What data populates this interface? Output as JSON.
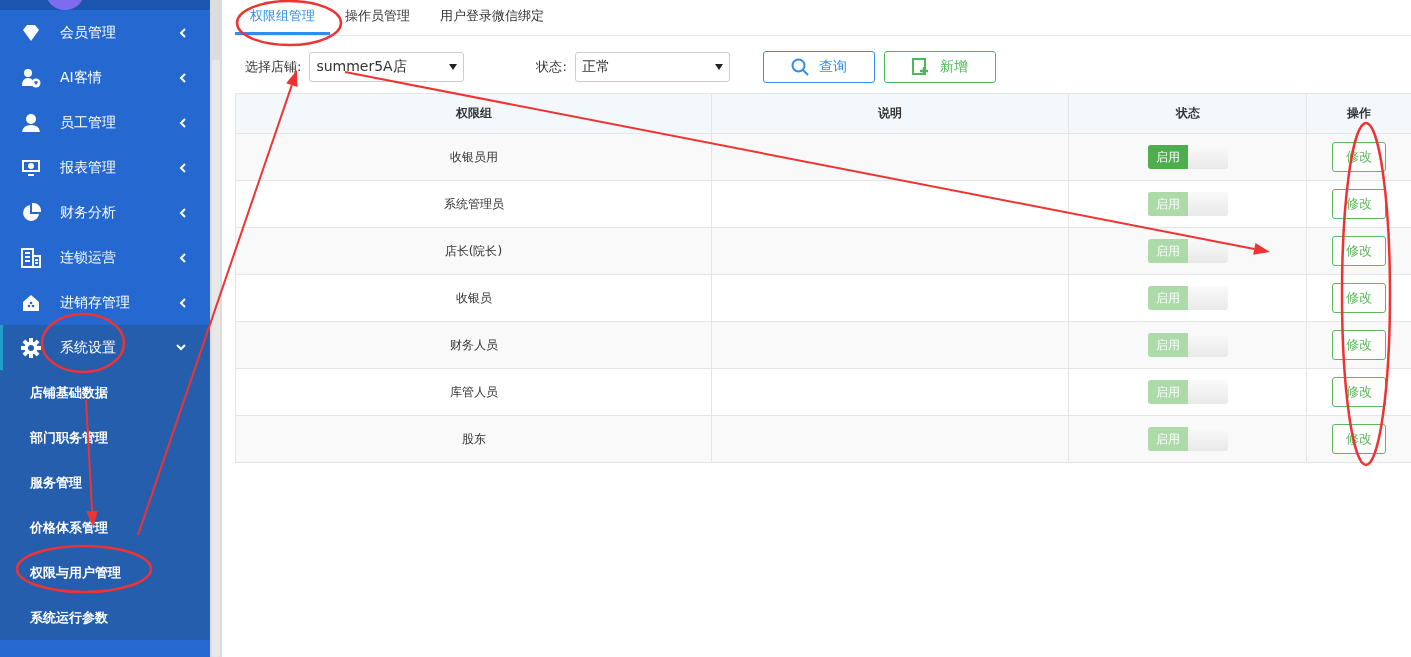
{
  "sidebar": {
    "items": [
      {
        "label": "会员管理",
        "expanded": false
      },
      {
        "label": "AI客情",
        "expanded": false
      },
      {
        "label": "员工管理",
        "expanded": false
      },
      {
        "label": "报表管理",
        "expanded": false
      },
      {
        "label": "财务分析",
        "expanded": false
      },
      {
        "label": "连锁运营",
        "expanded": false
      },
      {
        "label": "进销存管理",
        "expanded": false
      },
      {
        "label": "系统设置",
        "expanded": true,
        "children": [
          {
            "label": "店铺基础数据"
          },
          {
            "label": "部门职务管理"
          },
          {
            "label": "服务管理"
          },
          {
            "label": "价格体系管理"
          },
          {
            "label": "权限与用户管理"
          },
          {
            "label": "系统运行参数"
          }
        ]
      }
    ]
  },
  "tabs": [
    {
      "label": "权限组管理",
      "selected": true
    },
    {
      "label": "操作员管理",
      "selected": false
    },
    {
      "label": "用户登录微信绑定",
      "selected": false
    }
  ],
  "filters": [
    {
      "label": "选择店铺:",
      "value": "summer5A店"
    },
    {
      "label": "状态:",
      "value": "正常"
    }
  ],
  "buttons": [
    {
      "kind": "search",
      "label": "查询"
    },
    {
      "kind": "add",
      "label": "新增"
    }
  ],
  "table": {
    "columns": [
      "权限组",
      "说明",
      "状态",
      "操作"
    ],
    "rows": [
      {
        "name": "收银员用",
        "status": {
          "label": "启用",
          "disabled": false
        },
        "action": "修改"
      },
      {
        "name": "系统管理员",
        "status": {
          "label": "启用",
          "disabled": true
        },
        "action": "修改"
      },
      {
        "name": "店长(院长)",
        "status": {
          "label": "启用",
          "disabled": true
        },
        "action": "修改"
      },
      {
        "name": "收银员",
        "status": {
          "label": "启用",
          "disabled": true
        },
        "action": "修改"
      },
      {
        "name": "财务人员",
        "status": {
          "label": "启用",
          "disabled": true
        },
        "action": "修改"
      },
      {
        "name": "库管人员",
        "status": {
          "label": "启用",
          "disabled": true
        },
        "action": "修改"
      },
      {
        "name": "股东",
        "status": {
          "label": "启用",
          "disabled": true
        },
        "action": "修改"
      }
    ]
  }
}
